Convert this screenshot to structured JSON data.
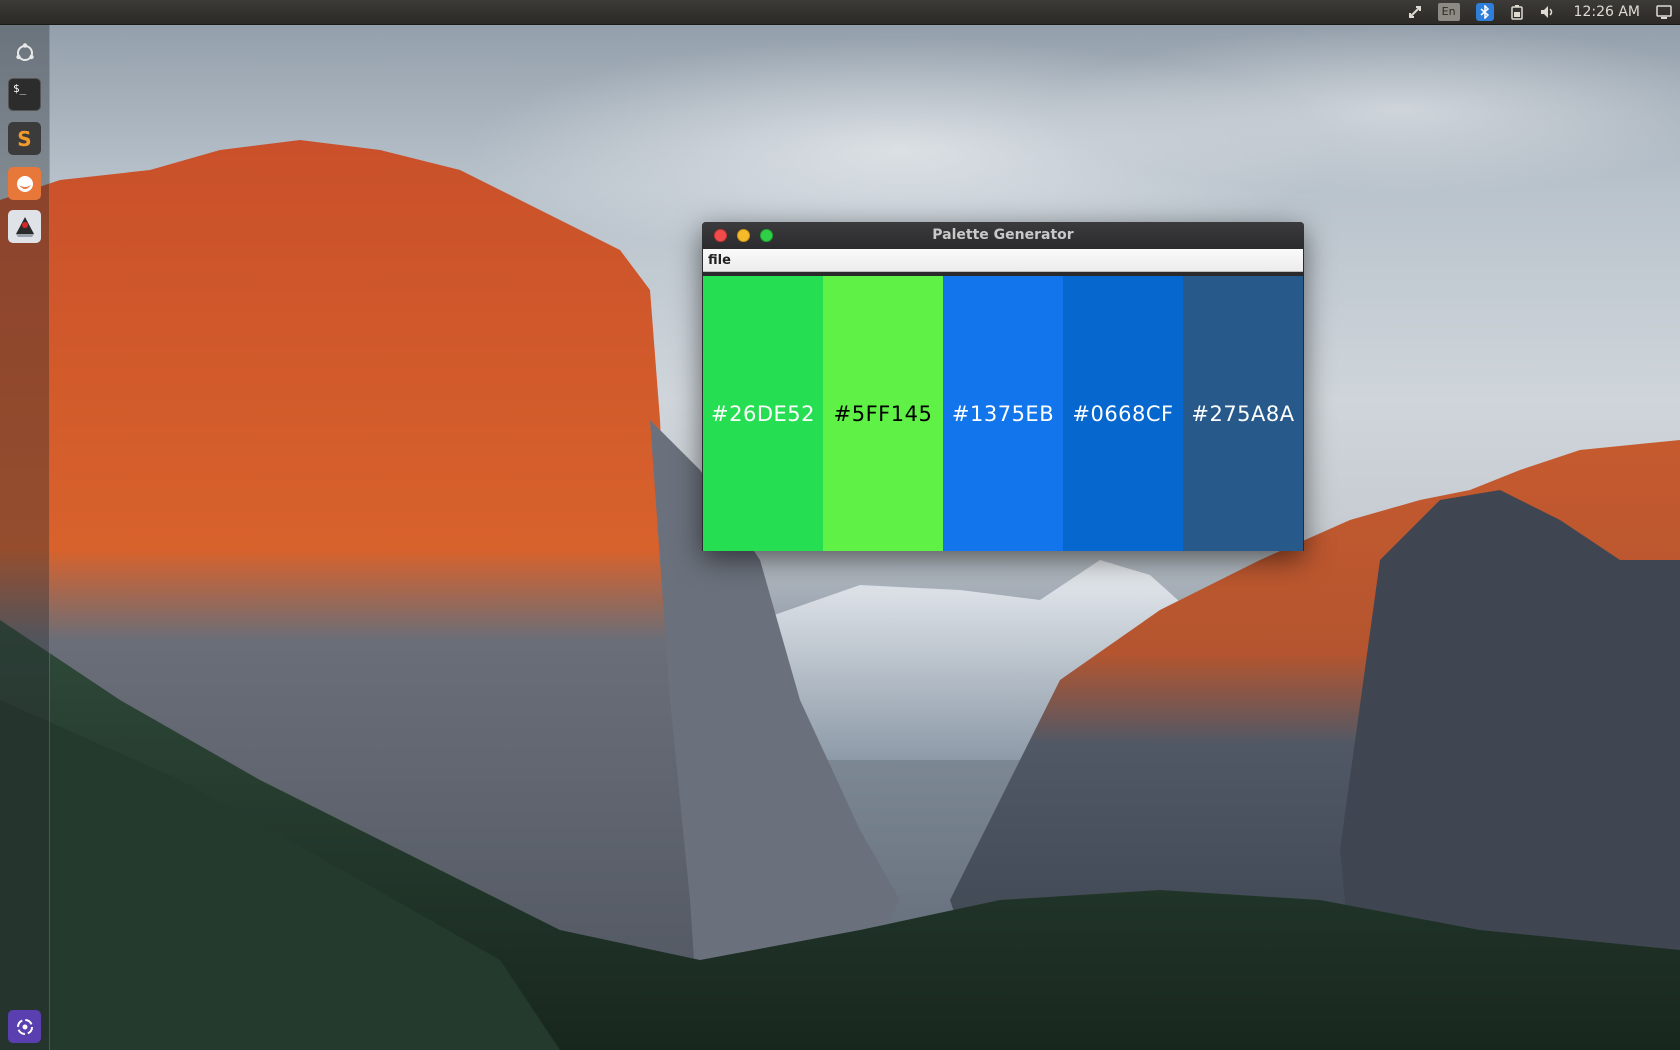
{
  "panel": {
    "keyboard_layout": "En",
    "clock": "12:26 AM",
    "tray_icons": [
      "network-icon",
      "keyboard-icon",
      "bluetooth-icon",
      "battery-icon",
      "volume-icon",
      "session-icon"
    ]
  },
  "launcher": {
    "items": [
      {
        "name": "dash-home",
        "icon": "ubuntu-logo-icon"
      },
      {
        "name": "terminal",
        "icon": "terminal-icon"
      },
      {
        "name": "sublime-text",
        "icon": "sublime-text-icon"
      },
      {
        "name": "firefox",
        "icon": "firefox-icon"
      },
      {
        "name": "java-app",
        "icon": "java-duke-icon"
      }
    ],
    "trash_icon": "trash-icon"
  },
  "window": {
    "title": "Palette Generator",
    "menu": [
      {
        "label": "file"
      }
    ],
    "swatches": [
      {
        "code": "#26DE52",
        "color": "#26DE52",
        "text_color": "#ffffff"
      },
      {
        "code": "#5FF145",
        "color": "#5FF145",
        "text_color": "#000000"
      },
      {
        "code": "#1375EB",
        "color": "#1375EB",
        "text_color": "#ffffff"
      },
      {
        "code": "#0668CF",
        "color": "#0668CF",
        "text_color": "#ffffff"
      },
      {
        "code": "#275A8A",
        "color": "#275A8A",
        "text_color": "#ffffff"
      }
    ]
  }
}
